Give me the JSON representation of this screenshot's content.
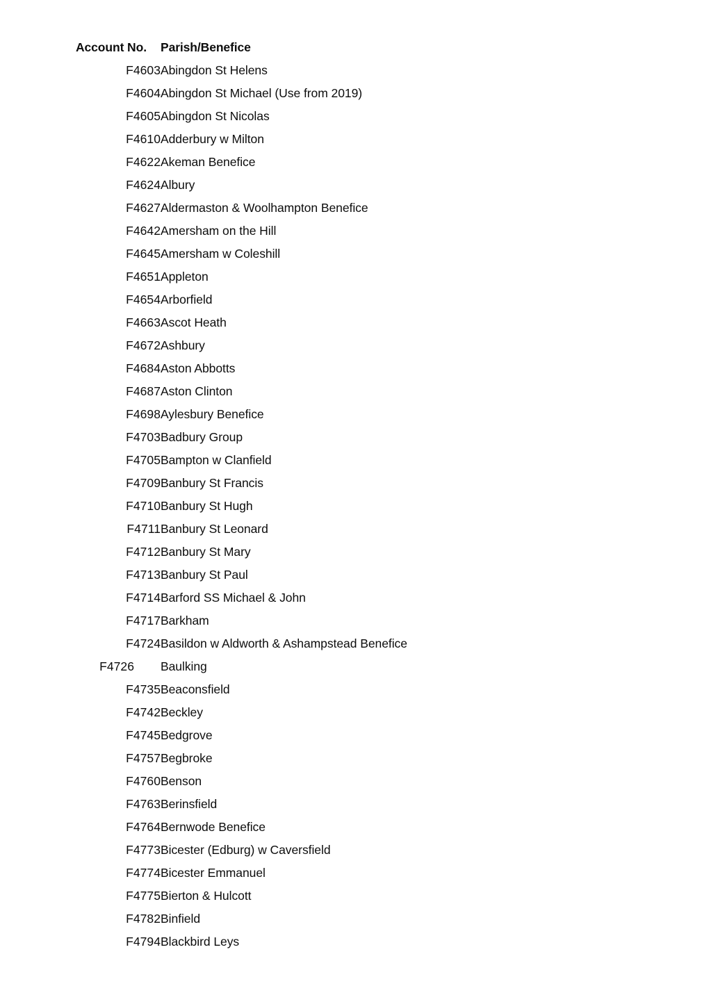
{
  "document": {
    "table": {
      "columns": [
        {
          "key": "account_no",
          "label": "Account No."
        },
        {
          "key": "parish",
          "label": "Parish/Benefice"
        }
      ],
      "rows": [
        {
          "account_no": "F4603",
          "parish": "Abingdon St Helens"
        },
        {
          "account_no": "F4604",
          "parish": "Abingdon St Michael (Use from 2019)"
        },
        {
          "account_no": "F4605",
          "parish": "Abingdon St Nicolas"
        },
        {
          "account_no": "F4610",
          "parish": "Adderbury w Milton"
        },
        {
          "account_no": "F4622",
          "parish": "Akeman Benefice"
        },
        {
          "account_no": "F4624",
          "parish": "Albury"
        },
        {
          "account_no": "F4627",
          "parish": "Aldermaston & Woolhampton Benefice"
        },
        {
          "account_no": "F4642",
          "parish": "Amersham on the Hill"
        },
        {
          "account_no": "F4645",
          "parish": "Amersham w Coleshill"
        },
        {
          "account_no": "F4651",
          "parish": "Appleton"
        },
        {
          "account_no": "F4654",
          "parish": "Arborfield"
        },
        {
          "account_no": "F4663",
          "parish": "Ascot Heath"
        },
        {
          "account_no": "F4672",
          "parish": "Ashbury"
        },
        {
          "account_no": "F4684",
          "parish": "Aston Abbotts"
        },
        {
          "account_no": "F4687",
          "parish": "Aston Clinton"
        },
        {
          "account_no": "F4698",
          "parish": "Aylesbury Benefice"
        },
        {
          "account_no": "F4703",
          "parish": "Badbury Group"
        },
        {
          "account_no": "F4705",
          "parish": "Bampton w Clanfield"
        },
        {
          "account_no": "F4709",
          "parish": "Banbury St Francis"
        },
        {
          "account_no": "F4710",
          "parish": "Banbury St Hugh"
        },
        {
          "account_no": "F4711",
          "parish": "Banbury St Leonard"
        },
        {
          "account_no": "F4712",
          "parish": "Banbury St Mary"
        },
        {
          "account_no": "F4713",
          "parish": "Banbury St Paul"
        },
        {
          "account_no": "F4714",
          "parish": "Barford SS Michael & John"
        },
        {
          "account_no": "F4717",
          "parish": "Barkham"
        },
        {
          "account_no": "F4724",
          "parish": "Basildon w Aldworth & Ashampstead Benefice"
        },
        {
          "account_no": "F4726",
          "parish": "Baulking",
          "shifted": true
        },
        {
          "account_no": "F4735",
          "parish": "Beaconsfield"
        },
        {
          "account_no": "F4742",
          "parish": "Beckley"
        },
        {
          "account_no": "F4745",
          "parish": "Bedgrove"
        },
        {
          "account_no": "F4757",
          "parish": "Begbroke"
        },
        {
          "account_no": "F4760",
          "parish": "Benson"
        },
        {
          "account_no": "F4763",
          "parish": "Berinsfield"
        },
        {
          "account_no": "F4764",
          "parish": "Bernwode Benefice"
        },
        {
          "account_no": "F4773",
          "parish": "Bicester (Edburg) w Caversfield"
        },
        {
          "account_no": "F4774",
          "parish": "Bicester Emmanuel"
        },
        {
          "account_no": "F4775",
          "parish": "Bierton & Hulcott"
        },
        {
          "account_no": "F4782",
          "parish": "Binfield"
        },
        {
          "account_no": "F4794",
          "parish": "Blackbird Leys"
        }
      ]
    }
  }
}
